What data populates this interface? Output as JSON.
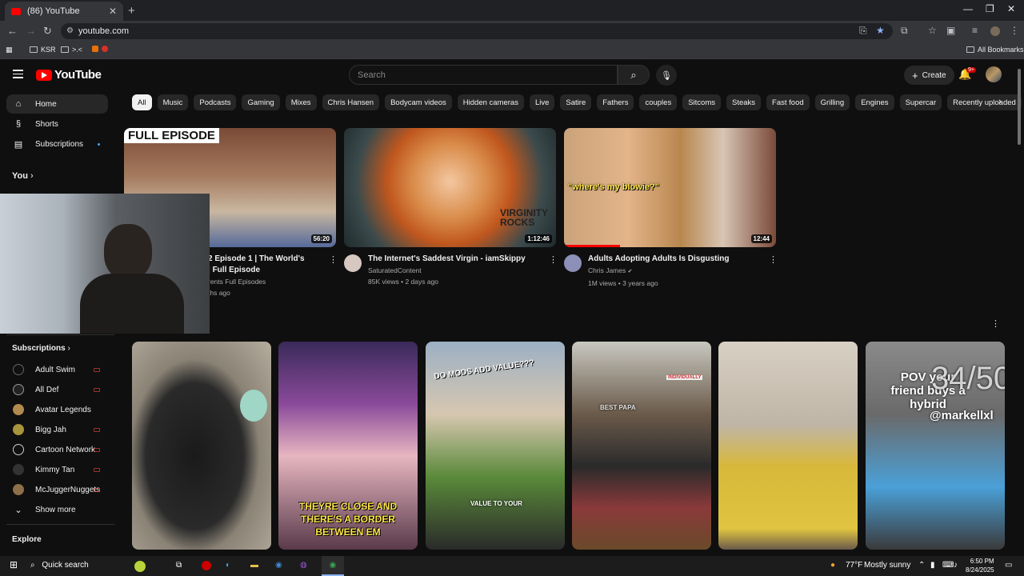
{
  "browser": {
    "tab_title": "(86) YouTube",
    "url": "youtube.com",
    "bookmarks": [
      "KSR",
      ">.<"
    ],
    "all_bookmarks": "All Bookmarks"
  },
  "header": {
    "logo": "YouTube",
    "search_placeholder": "Search",
    "create_label": "Create",
    "notif_badge": "9+"
  },
  "sidebar": {
    "main": [
      {
        "label": "Home",
        "icon": "home-icon"
      },
      {
        "label": "Shorts",
        "icon": "shorts-icon"
      },
      {
        "label": "Subscriptions",
        "icon": "subscriptions-icon"
      }
    ],
    "you_label": "You",
    "subscriptions_heading": "Subscriptions",
    "subscriptions": [
      "Adult Swim",
      "All Def",
      "Avatar Legends",
      "Bigg Jah",
      "Cartoon Network",
      "Kimmy Tan",
      "McJuggerNuggets"
    ],
    "show_more": "Show more",
    "explore_heading": "Explore"
  },
  "chips": [
    "All",
    "Music",
    "Podcasts",
    "Gaming",
    "Mixes",
    "Chris Hansen",
    "Bodycam videos",
    "Hidden cameras",
    "Live",
    "Satire",
    "Fathers",
    "couples",
    "Sitcoms",
    "Steaks",
    "Fast food",
    "Grilling",
    "Engines",
    "Supercar",
    "Recently uploaded"
  ],
  "videos": [
    {
      "title_line1": "2 Episode 1 | The World's",
      "title_line2": "| Full Episode",
      "channel": "rents Full Episodes",
      "meta": "ths ago",
      "duration": "56:20",
      "overlay": "FULL EPISODE"
    },
    {
      "title_line1": "The Internet's Saddest Virgin - iamSkippy",
      "channel": "SaturatedContent",
      "meta": "85K views • 2 days ago",
      "duration": "1:12:46",
      "overlay": "VIRGINITY ROCKS"
    },
    {
      "title_line1": "Adults Adopting Adults Is Disgusting",
      "channel": "Chris James",
      "meta": "1M views • 3 years ago",
      "duration": "12:44",
      "overlay": "\"where's my blowie?\""
    }
  ],
  "shorts": [
    {
      "caption": ""
    },
    {
      "caption": "THEYRE CLOSE AND THERE'S A BORDER BETWEEN EM"
    },
    {
      "caption": "DO MODS ADD VALUE???",
      "caption2": "VALUE TO YOUR"
    },
    {
      "caption": "BEST PAPA",
      "caption2": "INDIVIDUALLY"
    },
    {
      "caption": ""
    },
    {
      "caption": "POV your friend buys a hybrid",
      "caption2": "@markellxl",
      "caption3": "34/50"
    }
  ],
  "taskbar": {
    "search": "Quick search",
    "weather": "77°F",
    "weather_desc": "Mostly sunny",
    "time": "6:50 PM",
    "date": "8/24/2025"
  }
}
